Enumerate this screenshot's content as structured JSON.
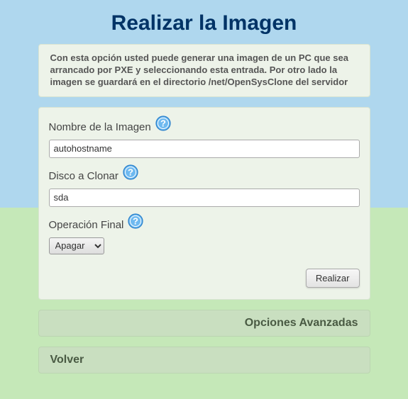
{
  "page": {
    "title": "Realizar la Imagen"
  },
  "info": {
    "text": "Con esta opción usted puede generar una imagen de un PC que sea arrancado por PXE y seleccionando esta entrada. Por otro lado la imagen se guardará en el directorio /net/OpenSysClone del servidor"
  },
  "form": {
    "image_name": {
      "label": "Nombre de la Imagen",
      "value": "autohostname"
    },
    "disk": {
      "label": "Disco a Clonar",
      "value": "sda"
    },
    "final_op": {
      "label": "Operación Final",
      "selected": "Apagar"
    },
    "submit_label": "Realizar"
  },
  "nav": {
    "advanced": "Opciones Avanzadas",
    "back": "Volver"
  },
  "icons": {
    "help_bg": "#6eb9f0",
    "help_border": "#2a7fc9",
    "help_fg": "#ffffff"
  }
}
